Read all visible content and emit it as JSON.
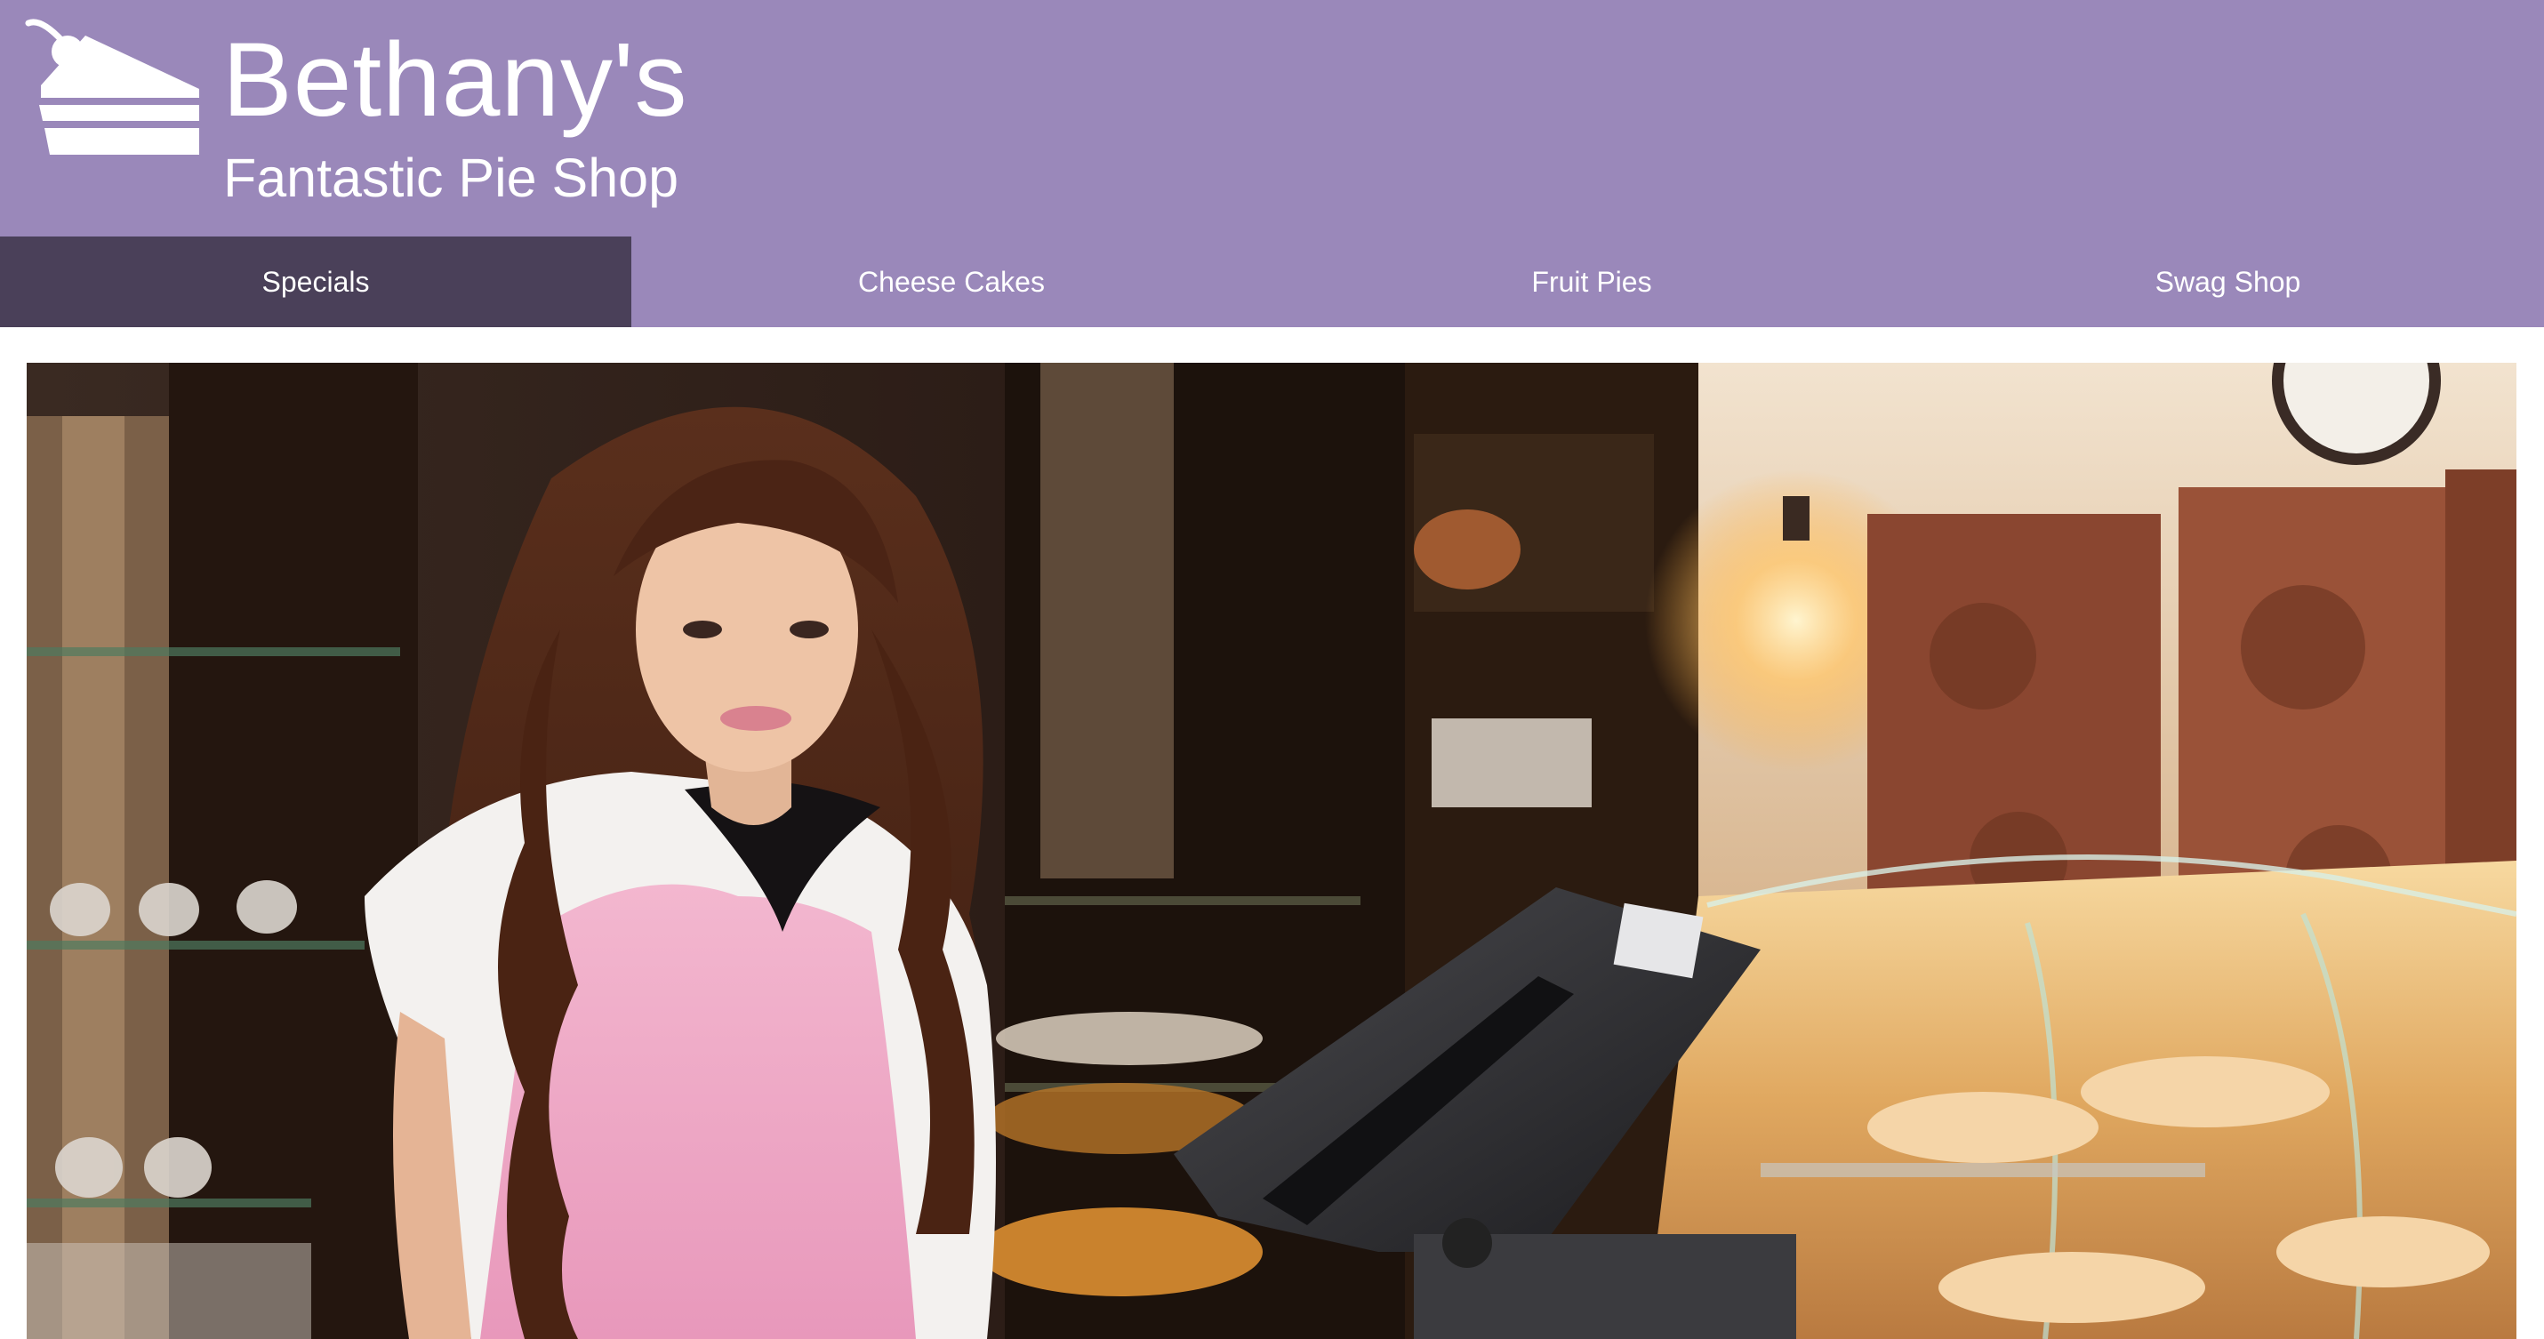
{
  "brand": {
    "name": "Bethany's",
    "tagline": "Fantastic Pie Shop",
    "logo_icon": "cake-slice-icon"
  },
  "nav": {
    "items": [
      {
        "label": "Specials",
        "active": true
      },
      {
        "label": "Cheese Cakes",
        "active": false
      },
      {
        "label": "Fruit Pies",
        "active": false
      },
      {
        "label": "Swag Shop",
        "active": false
      }
    ]
  },
  "hero": {
    "image": "bakery-clerk-photo"
  },
  "colors": {
    "header_bg": "#9a88ba",
    "nav_active_bg": "#4a4059",
    "text": "#ffffff"
  }
}
